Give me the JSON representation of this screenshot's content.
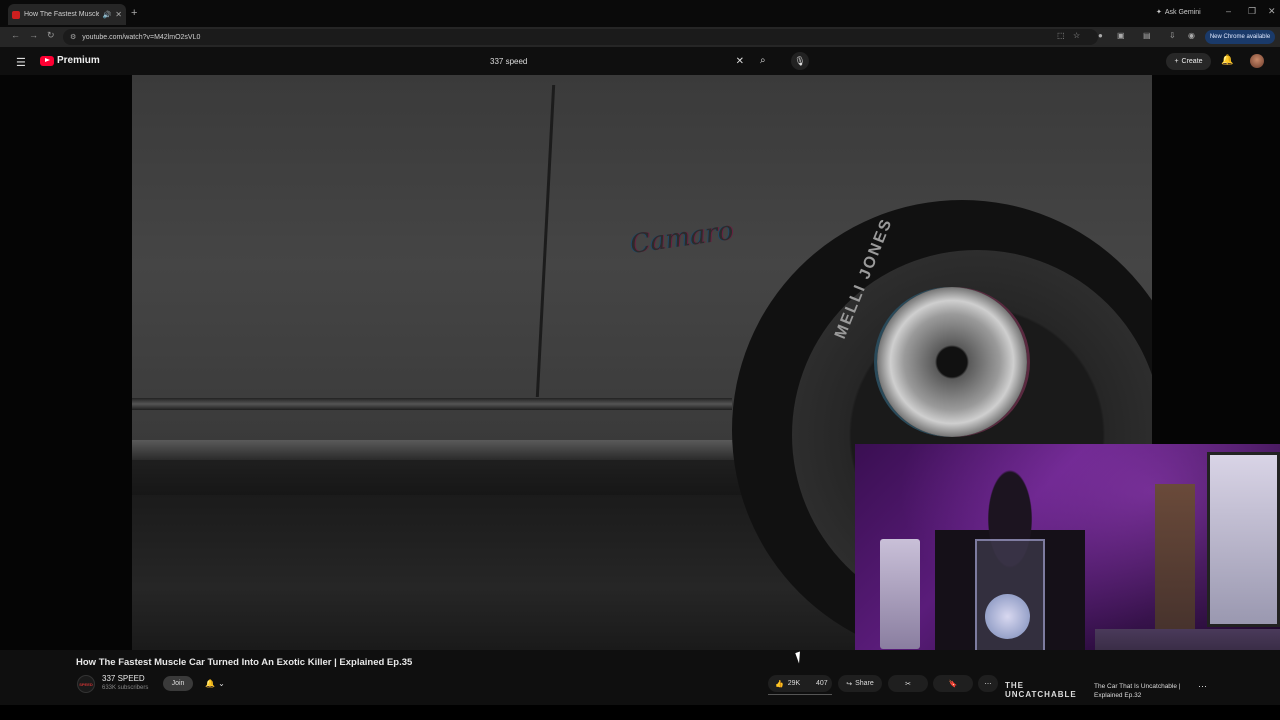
{
  "browser": {
    "tab_title": "How The Fastest Muscle Ca",
    "tab_audio_icon": "speaker-icon",
    "new_tab": "+",
    "ask_gemini": "Ask Gemini",
    "url": "youtube.com/watch?v=M42lmO2sVL0",
    "new_chrome_label": "New Chrome available",
    "window_controls": [
      "–",
      "❐",
      "✕"
    ]
  },
  "youtube": {
    "logo_text": "Premium",
    "search_query": "337 speed",
    "create_label": "Create"
  },
  "video": {
    "emblem_text": "Camaro",
    "tire_text": "MELLI JONES",
    "title": "How The Fastest Muscle Car Turned Into An Exotic Killer | Explained Ep.35",
    "channel_name": "337 SPEED",
    "channel_avatar_text": "SPEED",
    "subscribers": "633K subscribers",
    "join_label": "Join",
    "likes": "29K",
    "dislikes": "407",
    "share_label": "Share"
  },
  "recommendation": {
    "thumb_line1": "THE",
    "thumb_line2": "UNCATCHABLE",
    "title": "The Car That Is Uncatchable | Explained Ep.32"
  },
  "colors": {
    "youtube_red": "#ff0033",
    "webcam_purple": "#5a1c7a",
    "new_chrome_blue": "#1a3a6a"
  }
}
